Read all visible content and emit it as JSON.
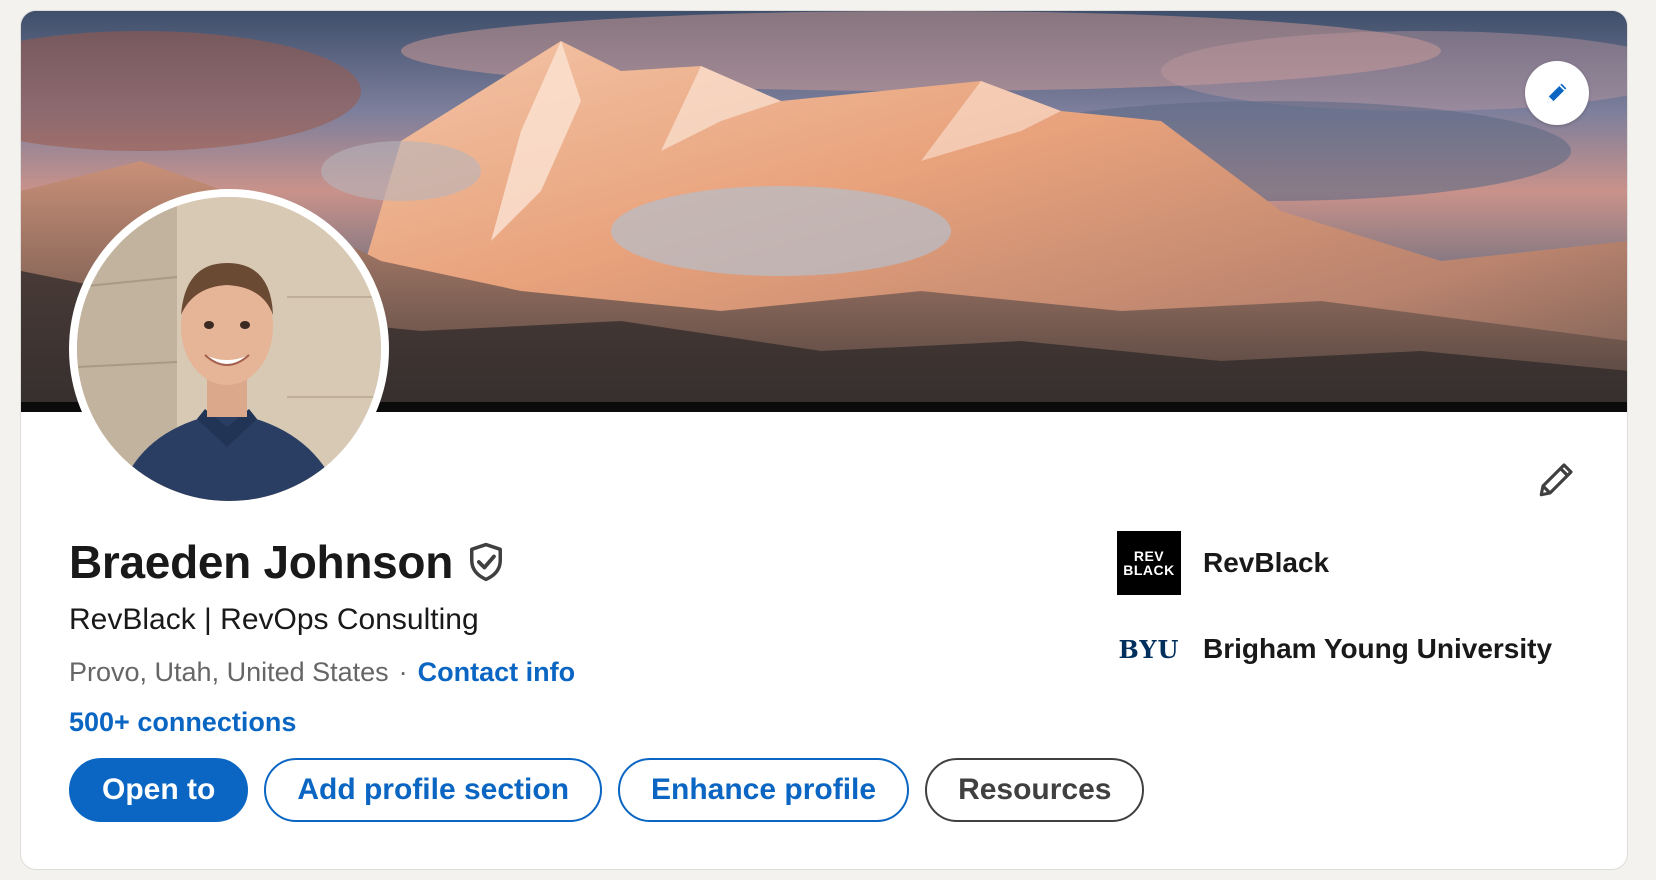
{
  "profile": {
    "name": "Braeden Johnson",
    "headline": "RevBlack | RevOps Consulting",
    "location": "Provo, Utah, United States",
    "separator": "·",
    "contact_info_label": "Contact info",
    "connections_label": "500+ connections"
  },
  "actions": {
    "open_to": "Open to",
    "add_profile_section": "Add profile section",
    "enhance_profile": "Enhance profile",
    "resources": "Resources"
  },
  "experience": [
    {
      "name": "RevBlack",
      "logo_line1": "REV",
      "logo_line2": "BLACK"
    },
    {
      "name": "Brigham Young University",
      "logo": "BYU"
    }
  ],
  "icons": {
    "banner_edit": "pencil-icon",
    "intro_edit": "pencil-outline-icon",
    "verified": "verified-shield-icon"
  },
  "colors": {
    "accent": "#0a66c2",
    "text_primary": "#191919",
    "text_secondary": "#666666",
    "neutral_button": "#404040",
    "byu_blue": "#002e5d"
  }
}
